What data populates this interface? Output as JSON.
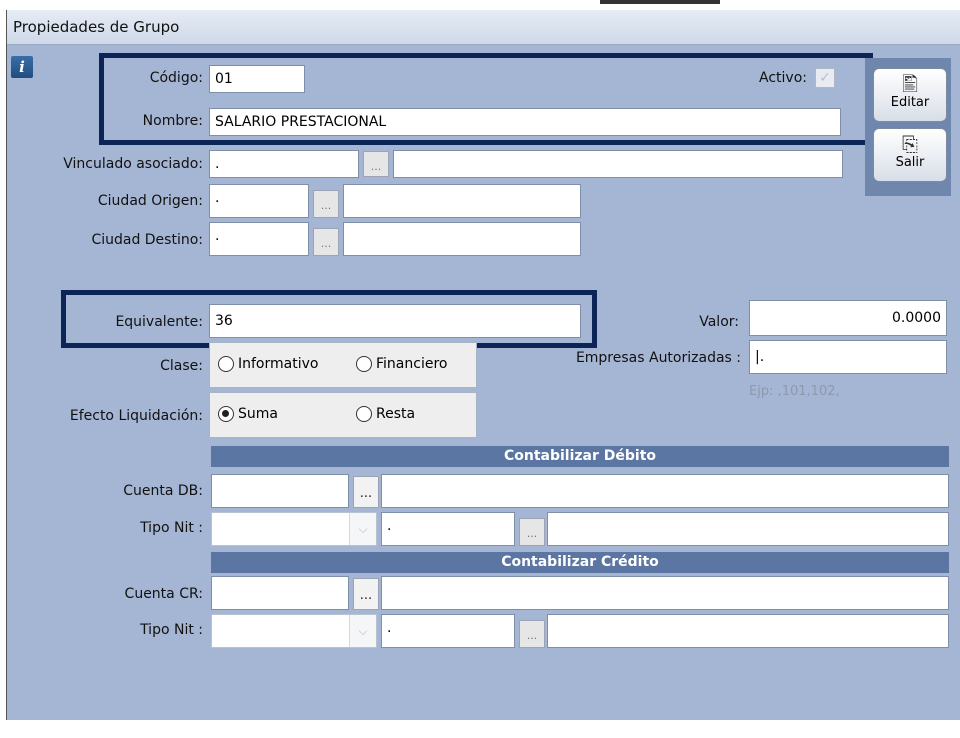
{
  "window": {
    "title": "Propiedades de Grupo"
  },
  "icons": {
    "info": "i",
    "check": "✓",
    "editar": "🖺",
    "salir": "⎘",
    "combo_arrow": "⌵"
  },
  "form": {
    "codigo": {
      "label": "Código:",
      "value": "01"
    },
    "activo": {
      "label": "Activo:",
      "checked": true
    },
    "nombre": {
      "label": "Nombre:",
      "value": "SALARIO PRESTACIONAL"
    },
    "vinculado": {
      "label": "Vinculado asociado:",
      "code": ".",
      "desc": ""
    },
    "ciudad_origen": {
      "label": "Ciudad Origen:",
      "code": ".",
      "desc": ""
    },
    "ciudad_destino": {
      "label": "Ciudad Destino:",
      "code": ".",
      "desc": ""
    },
    "equivalente": {
      "label": "Equivalente:",
      "value": "36"
    },
    "valor": {
      "label": "Valor:",
      "value": "0.0000"
    },
    "empresas": {
      "label": "Empresas Autorizadas :",
      "value": "|.",
      "hint": "Ejp: ,101,102,"
    },
    "clase": {
      "label": "Clase:",
      "options": [
        "Informativo",
        "Financiero"
      ],
      "selected": ""
    },
    "efecto": {
      "label": "Efecto Liquidación:",
      "options": [
        "Suma",
        "Resta"
      ],
      "selected": "Suma"
    }
  },
  "debito": {
    "title": "Contabilizar Débito",
    "cuenta_label": "Cuenta DB:",
    "tipo_label": "Tipo Nit :",
    "tipo_code": "."
  },
  "credito": {
    "title": "Contabilizar Crédito",
    "cuenta_label": "Cuenta CR:",
    "tipo_label": "Tipo Nit :",
    "tipo_code": "."
  },
  "toolbar": {
    "editar": "Editar",
    "salir": "Salir"
  },
  "lookup": "..."
}
